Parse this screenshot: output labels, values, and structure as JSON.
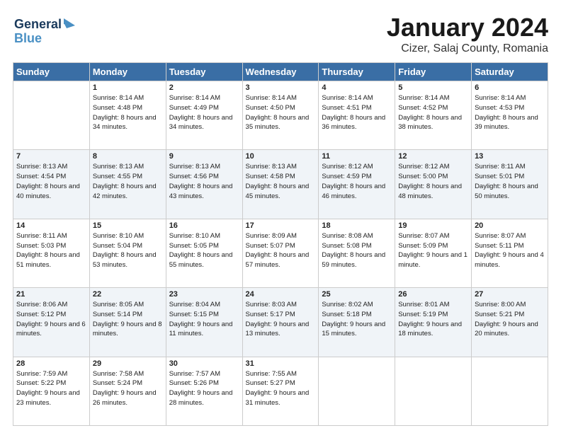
{
  "header": {
    "logo_line1": "General",
    "logo_line2": "Blue",
    "main_title": "January 2024",
    "subtitle": "Cizer, Salaj County, Romania"
  },
  "weekdays": [
    "Sunday",
    "Monday",
    "Tuesday",
    "Wednesday",
    "Thursday",
    "Friday",
    "Saturday"
  ],
  "weeks": [
    [
      {
        "num": "",
        "sunrise": "",
        "sunset": "",
        "daylight": ""
      },
      {
        "num": "1",
        "sunrise": "Sunrise: 8:14 AM",
        "sunset": "Sunset: 4:48 PM",
        "daylight": "Daylight: 8 hours and 34 minutes."
      },
      {
        "num": "2",
        "sunrise": "Sunrise: 8:14 AM",
        "sunset": "Sunset: 4:49 PM",
        "daylight": "Daylight: 8 hours and 34 minutes."
      },
      {
        "num": "3",
        "sunrise": "Sunrise: 8:14 AM",
        "sunset": "Sunset: 4:50 PM",
        "daylight": "Daylight: 8 hours and 35 minutes."
      },
      {
        "num": "4",
        "sunrise": "Sunrise: 8:14 AM",
        "sunset": "Sunset: 4:51 PM",
        "daylight": "Daylight: 8 hours and 36 minutes."
      },
      {
        "num": "5",
        "sunrise": "Sunrise: 8:14 AM",
        "sunset": "Sunset: 4:52 PM",
        "daylight": "Daylight: 8 hours and 38 minutes."
      },
      {
        "num": "6",
        "sunrise": "Sunrise: 8:14 AM",
        "sunset": "Sunset: 4:53 PM",
        "daylight": "Daylight: 8 hours and 39 minutes."
      }
    ],
    [
      {
        "num": "7",
        "sunrise": "Sunrise: 8:13 AM",
        "sunset": "Sunset: 4:54 PM",
        "daylight": "Daylight: 8 hours and 40 minutes."
      },
      {
        "num": "8",
        "sunrise": "Sunrise: 8:13 AM",
        "sunset": "Sunset: 4:55 PM",
        "daylight": "Daylight: 8 hours and 42 minutes."
      },
      {
        "num": "9",
        "sunrise": "Sunrise: 8:13 AM",
        "sunset": "Sunset: 4:56 PM",
        "daylight": "Daylight: 8 hours and 43 minutes."
      },
      {
        "num": "10",
        "sunrise": "Sunrise: 8:13 AM",
        "sunset": "Sunset: 4:58 PM",
        "daylight": "Daylight: 8 hours and 45 minutes."
      },
      {
        "num": "11",
        "sunrise": "Sunrise: 8:12 AM",
        "sunset": "Sunset: 4:59 PM",
        "daylight": "Daylight: 8 hours and 46 minutes."
      },
      {
        "num": "12",
        "sunrise": "Sunrise: 8:12 AM",
        "sunset": "Sunset: 5:00 PM",
        "daylight": "Daylight: 8 hours and 48 minutes."
      },
      {
        "num": "13",
        "sunrise": "Sunrise: 8:11 AM",
        "sunset": "Sunset: 5:01 PM",
        "daylight": "Daylight: 8 hours and 50 minutes."
      }
    ],
    [
      {
        "num": "14",
        "sunrise": "Sunrise: 8:11 AM",
        "sunset": "Sunset: 5:03 PM",
        "daylight": "Daylight: 8 hours and 51 minutes."
      },
      {
        "num": "15",
        "sunrise": "Sunrise: 8:10 AM",
        "sunset": "Sunset: 5:04 PM",
        "daylight": "Daylight: 8 hours and 53 minutes."
      },
      {
        "num": "16",
        "sunrise": "Sunrise: 8:10 AM",
        "sunset": "Sunset: 5:05 PM",
        "daylight": "Daylight: 8 hours and 55 minutes."
      },
      {
        "num": "17",
        "sunrise": "Sunrise: 8:09 AM",
        "sunset": "Sunset: 5:07 PM",
        "daylight": "Daylight: 8 hours and 57 minutes."
      },
      {
        "num": "18",
        "sunrise": "Sunrise: 8:08 AM",
        "sunset": "Sunset: 5:08 PM",
        "daylight": "Daylight: 8 hours and 59 minutes."
      },
      {
        "num": "19",
        "sunrise": "Sunrise: 8:07 AM",
        "sunset": "Sunset: 5:09 PM",
        "daylight": "Daylight: 9 hours and 1 minute."
      },
      {
        "num": "20",
        "sunrise": "Sunrise: 8:07 AM",
        "sunset": "Sunset: 5:11 PM",
        "daylight": "Daylight: 9 hours and 4 minutes."
      }
    ],
    [
      {
        "num": "21",
        "sunrise": "Sunrise: 8:06 AM",
        "sunset": "Sunset: 5:12 PM",
        "daylight": "Daylight: 9 hours and 6 minutes."
      },
      {
        "num": "22",
        "sunrise": "Sunrise: 8:05 AM",
        "sunset": "Sunset: 5:14 PM",
        "daylight": "Daylight: 9 hours and 8 minutes."
      },
      {
        "num": "23",
        "sunrise": "Sunrise: 8:04 AM",
        "sunset": "Sunset: 5:15 PM",
        "daylight": "Daylight: 9 hours and 11 minutes."
      },
      {
        "num": "24",
        "sunrise": "Sunrise: 8:03 AM",
        "sunset": "Sunset: 5:17 PM",
        "daylight": "Daylight: 9 hours and 13 minutes."
      },
      {
        "num": "25",
        "sunrise": "Sunrise: 8:02 AM",
        "sunset": "Sunset: 5:18 PM",
        "daylight": "Daylight: 9 hours and 15 minutes."
      },
      {
        "num": "26",
        "sunrise": "Sunrise: 8:01 AM",
        "sunset": "Sunset: 5:19 PM",
        "daylight": "Daylight: 9 hours and 18 minutes."
      },
      {
        "num": "27",
        "sunrise": "Sunrise: 8:00 AM",
        "sunset": "Sunset: 5:21 PM",
        "daylight": "Daylight: 9 hours and 20 minutes."
      }
    ],
    [
      {
        "num": "28",
        "sunrise": "Sunrise: 7:59 AM",
        "sunset": "Sunset: 5:22 PM",
        "daylight": "Daylight: 9 hours and 23 minutes."
      },
      {
        "num": "29",
        "sunrise": "Sunrise: 7:58 AM",
        "sunset": "Sunset: 5:24 PM",
        "daylight": "Daylight: 9 hours and 26 minutes."
      },
      {
        "num": "30",
        "sunrise": "Sunrise: 7:57 AM",
        "sunset": "Sunset: 5:26 PM",
        "daylight": "Daylight: 9 hours and 28 minutes."
      },
      {
        "num": "31",
        "sunrise": "Sunrise: 7:55 AM",
        "sunset": "Sunset: 5:27 PM",
        "daylight": "Daylight: 9 hours and 31 minutes."
      },
      {
        "num": "",
        "sunrise": "",
        "sunset": "",
        "daylight": ""
      },
      {
        "num": "",
        "sunrise": "",
        "sunset": "",
        "daylight": ""
      },
      {
        "num": "",
        "sunrise": "",
        "sunset": "",
        "daylight": ""
      }
    ]
  ]
}
